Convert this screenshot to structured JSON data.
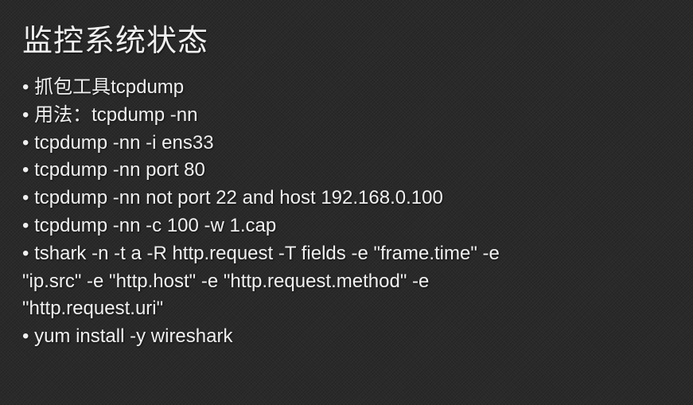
{
  "title": "监控系统状态",
  "bullets": [
    {
      "type": "bullet",
      "text": "抓包工具tcpdump"
    },
    {
      "type": "bullet",
      "text": "用法：tcpdump -nn"
    },
    {
      "type": "bullet",
      "text": "tcpdump -nn -i ens33"
    },
    {
      "type": "bullet",
      "text": "tcpdump -nn port 80"
    },
    {
      "type": "bullet",
      "text": "tcpdump -nn not port 22 and host 192.168.0.100"
    },
    {
      "type": "bullet",
      "text": "tcpdump -nn -c 100 -w 1.cap"
    },
    {
      "type": "bullet",
      "text": "tshark -n -t a -R http.request -T fields -e \"frame.time\" -e"
    },
    {
      "type": "cont",
      "text": "\"ip.src\" -e \"http.host\" -e \"http.request.method\" -e"
    },
    {
      "type": "cont",
      "text": "\"http.request.uri\""
    },
    {
      "type": "bullet",
      "text": "yum install -y wireshark"
    }
  ]
}
